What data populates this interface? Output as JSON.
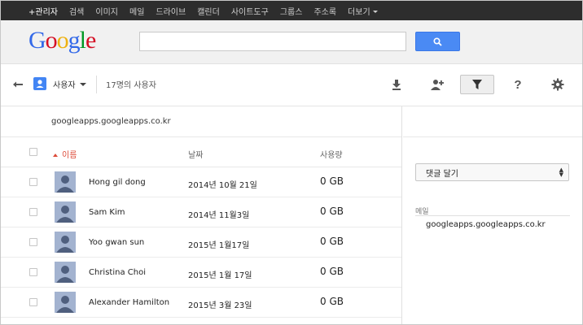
{
  "topnav": {
    "items": [
      "+관리자",
      "검색",
      "이미지",
      "메일",
      "드라이브",
      "캘린더",
      "사이트도구",
      "그룹스",
      "주소록",
      "더보기"
    ]
  },
  "logo": {
    "letters": [
      "G",
      "o",
      "o",
      "g",
      "l",
      "e"
    ],
    "colors": [
      "#3369e8",
      "#d50f25",
      "#eeb211",
      "#3369e8",
      "#009925",
      "#d50f25"
    ]
  },
  "search": {
    "value": "",
    "placeholder": ""
  },
  "toolbar": {
    "users_label": "사용자",
    "user_count": "17명의 사용자",
    "icons": [
      "download-icon",
      "add-user-icon",
      "filter-icon",
      "help-icon",
      "settings-icon"
    ]
  },
  "main": {
    "domain": "googleapps.googleapps.co.kr",
    "headers": {
      "name": "이름",
      "date": "날짜",
      "usage": "사용량"
    },
    "rows": [
      {
        "name": "Hong gil dong",
        "date": "2014년 10월 21일",
        "usage": "0 GB"
      },
      {
        "name": "Sam Kim",
        "date": "2014년 11월3일",
        "usage": "0 GB"
      },
      {
        "name": "Yoo gwan sun",
        "date": "2015년 1월17일",
        "usage": "0 GB"
      },
      {
        "name": "Christina Choi",
        "date": "2015년 1월 17일",
        "usage": "0 GB"
      },
      {
        "name": "Alexander Hamilton",
        "date": "2015년 3월 23일",
        "usage": "0 GB"
      }
    ]
  },
  "side": {
    "select_value": "댓글 달기",
    "mail_label": "메일",
    "mail_value": "googleapps.googleapps.co.kr"
  },
  "colors": {
    "accent_blue": "#4a8af4",
    "sort_red": "#dd4b39",
    "topbar": "#2d2d2d"
  }
}
